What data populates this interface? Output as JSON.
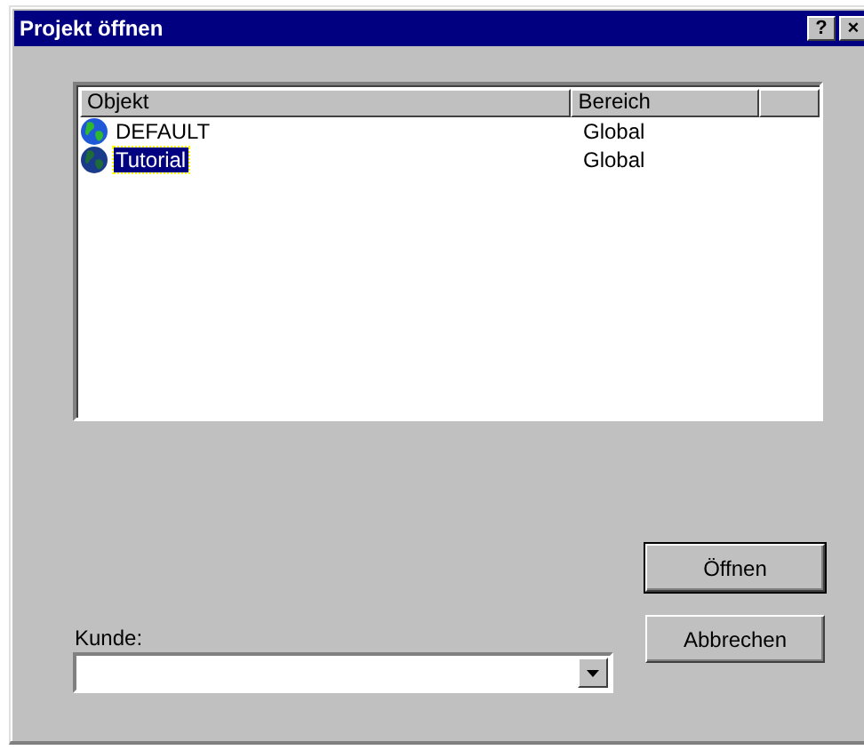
{
  "window": {
    "title": "Projekt öffnen",
    "title_buttons": [
      "?",
      "×"
    ]
  },
  "list": {
    "columns": [
      "Objekt",
      "Bereich"
    ],
    "rows": [
      {
        "name": "DEFAULT",
        "bereich": "Global",
        "selected": false
      },
      {
        "name": "Tutorial",
        "bereich": "Global",
        "selected": true
      }
    ]
  },
  "customer": {
    "label": "Kunde:"
  },
  "buttons": [
    "Öffnen",
    "Abbrechen"
  ]
}
